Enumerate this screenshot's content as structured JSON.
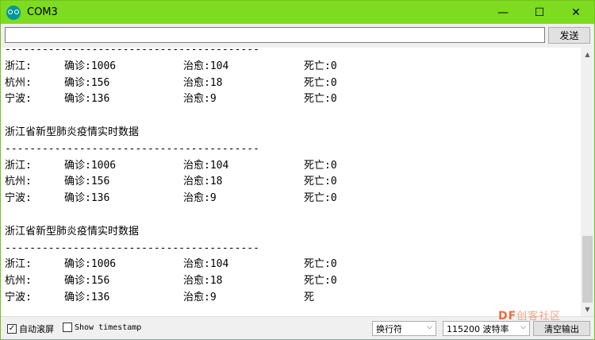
{
  "window": {
    "title": "COM3",
    "minimize_glyph": "—",
    "maximize_glyph": "☐",
    "close_glyph": "✕",
    "accent_color": "#7ddc1f"
  },
  "send_bar": {
    "input_value": "",
    "send_label": "发送"
  },
  "output": {
    "blocks": [
      {
        "separator": "-----------------------------------------",
        "rows": [
          [
            "浙江:",
            "确诊:1006",
            "治愈:104",
            "死亡:0"
          ],
          [
            "杭州:",
            "确诊:156",
            "治愈:18",
            "死亡:0"
          ],
          [
            "宁波:",
            "确诊:136",
            "治愈:9",
            "死亡:0"
          ]
        ]
      },
      {
        "heading": "浙江省新型肺炎疫情实时数据",
        "separator": "-----------------------------------------",
        "rows": [
          [
            "浙江:",
            "确诊:1006",
            "治愈:104",
            "死亡:0"
          ],
          [
            "杭州:",
            "确诊:156",
            "治愈:18",
            "死亡:0"
          ],
          [
            "宁波:",
            "确诊:136",
            "治愈:9",
            "死亡:0"
          ]
        ]
      },
      {
        "heading": "浙江省新型肺炎疫情实时数据",
        "separator": "-----------------------------------------",
        "rows": [
          [
            "浙江:",
            "确诊:1006",
            "治愈:104",
            "死亡:0"
          ],
          [
            "杭州:",
            "确诊:156",
            "治愈:18",
            "死亡:0"
          ],
          [
            "宁波:",
            "确诊:136",
            "治愈:9",
            "死"
          ]
        ]
      }
    ]
  },
  "status_bar": {
    "autoscroll_label": "自动滚屏",
    "autoscroll_checked": true,
    "timestamp_label": "Show timestamp",
    "timestamp_checked": false,
    "line_ending_value": "换行符",
    "baud_value": "115200 波特率",
    "clear_label": "清空输出"
  },
  "watermark": {
    "brand": "DF",
    "rest": "创客社区"
  }
}
